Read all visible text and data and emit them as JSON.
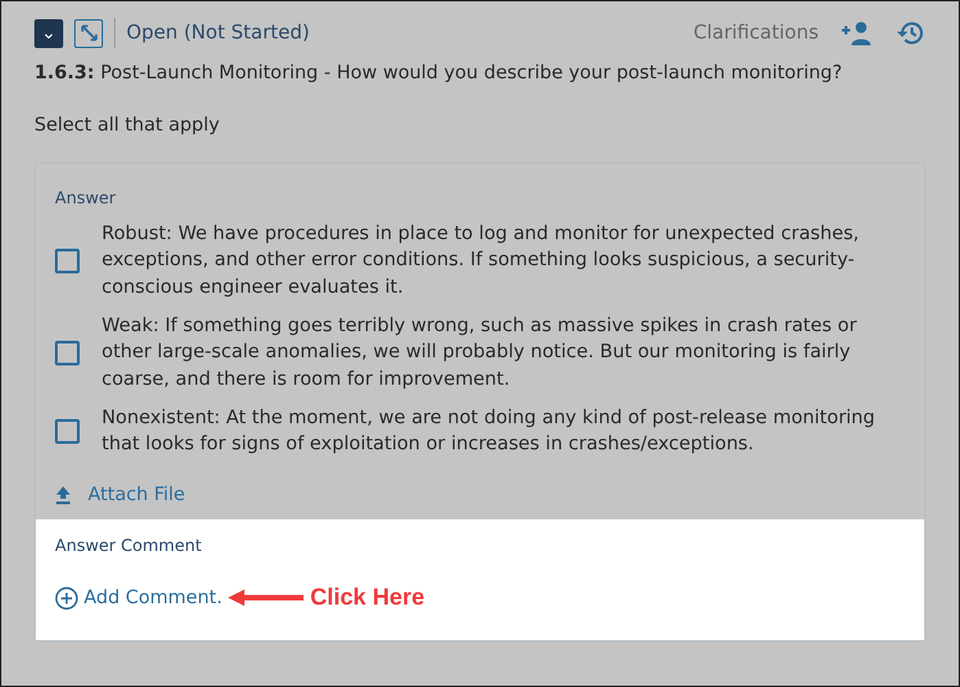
{
  "header": {
    "collapse_icon": "⌄",
    "status": "Open (Not Started)",
    "clarifications": "Clarifications"
  },
  "question": "**1.6.3:** Post-Launch Monitoring - How would you describe your post-launch monitoring?",
  "instruction": "Select all that apply",
  "answer": {
    "label": "Answer",
    "options": [
      {
        "text": "Robust: We have procedures in place to log and monitor for unexpected crashes, exceptions, and other error conditions. If something looks suspicious, a security-conscious engineer evaluates it.",
        "checked": false
      },
      {
        "text": "Weak: If something goes terribly wrong, such as massive spikes in crash rates or other large-scale anomalies, we will probably notice. But our monitoring is fairly coarse, and there is room for improvement.",
        "checked": false
      },
      {
        "text": "Nonexistent: At the moment, we are not doing any kind of post-release monitoring that looks for signs of exploitation or increases in crashes/exceptions.",
        "checked": false
      }
    ],
    "attach": "Attach File"
  },
  "comment": {
    "label": "Answer Comment",
    "add": "Add Comment.",
    "callout": "Click Here"
  }
}
